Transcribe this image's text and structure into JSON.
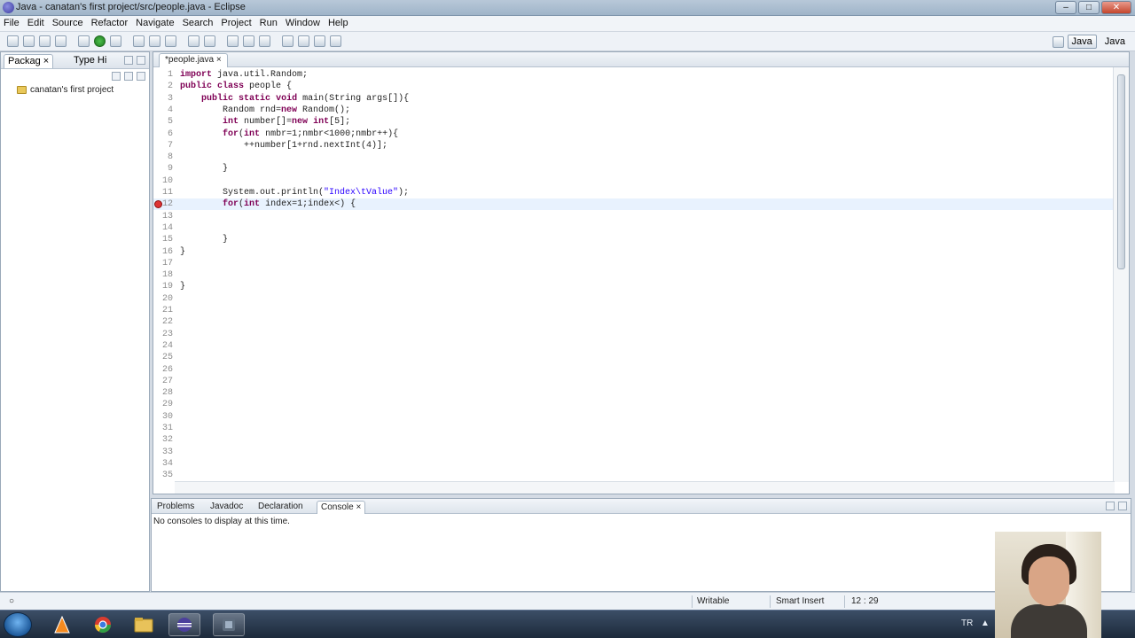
{
  "window": {
    "title": "Java - canatan's first project/src/people.java - Eclipse"
  },
  "menu": [
    "File",
    "Edit",
    "Source",
    "Refactor",
    "Navigate",
    "Search",
    "Project",
    "Run",
    "Window",
    "Help"
  ],
  "perspectives": {
    "first": "Java",
    "second": "Java"
  },
  "left_panel": {
    "tab_package": "Packag",
    "tab_type": "Type Hi",
    "project": "canatan's first project"
  },
  "editor": {
    "tab_label": "*people.java",
    "lines": [
      {
        "n": "1",
        "text": "import java.util.Random;"
      },
      {
        "n": "2",
        "text": "public class people {"
      },
      {
        "n": "3",
        "text": "    public static void main(String args[]){"
      },
      {
        "n": "4",
        "text": "        Random rnd=new Random();"
      },
      {
        "n": "5",
        "text": "        int number[]=new int[5];"
      },
      {
        "n": "6",
        "text": "        for(int nmbr=1;nmbr<1000;nmbr++){"
      },
      {
        "n": "7",
        "text": "            ++number[1+rnd.nextInt(4)];"
      },
      {
        "n": "8",
        "text": ""
      },
      {
        "n": "9",
        "text": "        }"
      },
      {
        "n": "10",
        "text": ""
      },
      {
        "n": "11",
        "text": "        System.out.println(\"Index\\tValue\");"
      },
      {
        "n": "12",
        "text": "        for(int index=1;index<) {"
      },
      {
        "n": "13",
        "text": ""
      },
      {
        "n": "14",
        "text": ""
      },
      {
        "n": "15",
        "text": "        }"
      },
      {
        "n": "16",
        "text": "}"
      },
      {
        "n": "17",
        "text": ""
      },
      {
        "n": "18",
        "text": ""
      },
      {
        "n": "19",
        "text": "}"
      },
      {
        "n": "20",
        "text": ""
      },
      {
        "n": "21",
        "text": ""
      },
      {
        "n": "22",
        "text": ""
      },
      {
        "n": "23",
        "text": ""
      },
      {
        "n": "24",
        "text": ""
      },
      {
        "n": "25",
        "text": ""
      },
      {
        "n": "26",
        "text": ""
      },
      {
        "n": "27",
        "text": ""
      },
      {
        "n": "28",
        "text": ""
      },
      {
        "n": "29",
        "text": ""
      },
      {
        "n": "30",
        "text": ""
      },
      {
        "n": "31",
        "text": ""
      },
      {
        "n": "32",
        "text": ""
      },
      {
        "n": "33",
        "text": ""
      },
      {
        "n": "34",
        "text": ""
      },
      {
        "n": "35",
        "text": ""
      }
    ],
    "current_line": "12",
    "error_line": "12"
  },
  "console": {
    "tabs": [
      "Problems",
      "Javadoc",
      "Declaration",
      "Console"
    ],
    "active_tab": "Console",
    "message": "No consoles to display at this time."
  },
  "status": {
    "writable": "Writable",
    "insert_mode": "Smart Insert",
    "position": "12 : 29"
  },
  "taskbar": {
    "language": "TR",
    "apps": [
      "vlc-icon",
      "chrome-icon",
      "explorer-icon",
      "eclipse-icon",
      "media-icon"
    ]
  },
  "colors": {
    "keyword": "#7f0055",
    "string": "#2a00ff",
    "current_line_bg": "#e8f2fe",
    "error": "#d33333"
  }
}
